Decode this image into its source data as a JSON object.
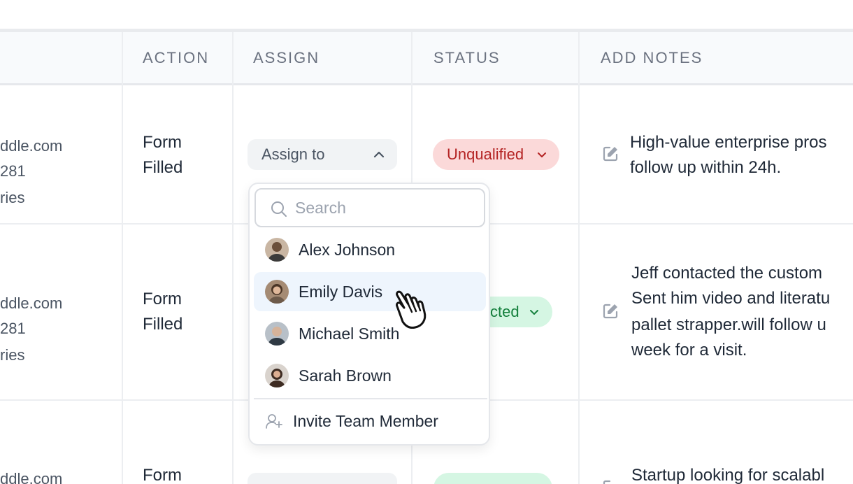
{
  "table": {
    "columns": [
      "ACTION",
      "ASSIGN",
      "STATUS",
      "ADD NOTES"
    ],
    "rows": [
      {
        "contact_email_partial": "ddle.com",
        "contact_phone_partial": "281",
        "contact_company_partial": "ries",
        "action": [
          "Form",
          "Filled"
        ],
        "assign_label": "Assign to",
        "status": "Unqualified",
        "notes": [
          "High-value enterprise pros",
          "follow up within 24h."
        ]
      },
      {
        "contact_email_partial": "ddle.com",
        "contact_phone_partial": "281",
        "contact_company_partial": "ries",
        "action": [
          "Form",
          "Filled"
        ],
        "status": "cted",
        "notes": [
          "Jeff contacted the custom",
          "Sent him video and literatu",
          "pallet strapper.will follow u",
          "week for a visit."
        ]
      },
      {
        "contact_email_partial": "ddle.com",
        "action": [
          "Form"
        ],
        "notes": [
          "Startup looking for scalabl"
        ]
      }
    ]
  },
  "assign_dropdown": {
    "search_placeholder": "Search",
    "members": [
      {
        "name": "Alex Johnson",
        "avatar_color": "#6b4f3a"
      },
      {
        "name": "Emily Davis",
        "avatar_color": "#7a5a45"
      },
      {
        "name": "Michael Smith",
        "avatar_color": "#55606b"
      },
      {
        "name": "Sarah Brown",
        "avatar_color": "#4a3a33"
      }
    ],
    "hovered_member": "Emily Davis",
    "invite_label": "Invite Team Member"
  },
  "colors": {
    "unqualified_bg": "#fbd9d9",
    "unqualified_text": "#b42323",
    "contacted_bg": "#d5f6e3",
    "contacted_text": "#15803d",
    "hover_bg": "#eef5fd"
  },
  "icons": {
    "assign_chevron": "chevron-up-icon",
    "status_chevron": "chevron-down-icon",
    "notes": "edit-icon",
    "search": "search-icon",
    "invite": "add-user-icon",
    "cursor": "hand-pointer-icon"
  }
}
